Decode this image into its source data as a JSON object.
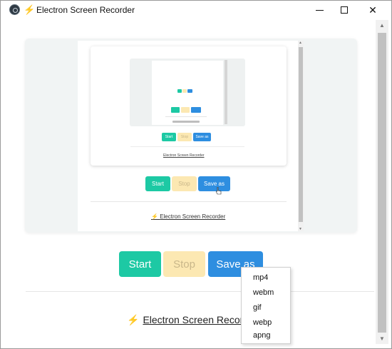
{
  "window": {
    "title": "Electron Screen Recorder",
    "minimize_icon": "minimize-icon",
    "maximize_icon": "maximize-icon",
    "close_glyph": "✕"
  },
  "controls": {
    "start_label": "Start",
    "stop_label": "Stop",
    "save_label": "Save as"
  },
  "footer": {
    "link_text": "Electron Screen Recorder",
    "icon": "lightning-bolt-icon"
  },
  "save_menu": {
    "options": [
      "mp4",
      "webm",
      "gif",
      "webp",
      "apng"
    ]
  },
  "preview": {
    "start_label": "Start",
    "stop_label": "Stop",
    "save_label": "Save as",
    "footer_text": "Electron Screen Recorder",
    "nested_start_label": "Start",
    "nested_stop_label": "Stop",
    "nested_save_label": "Save as",
    "nested_footer_text": "Electron Screen Recorder"
  },
  "colors": {
    "start": "#1dc9a4",
    "stop": "#fce8b2",
    "save": "#2e8ee0"
  }
}
